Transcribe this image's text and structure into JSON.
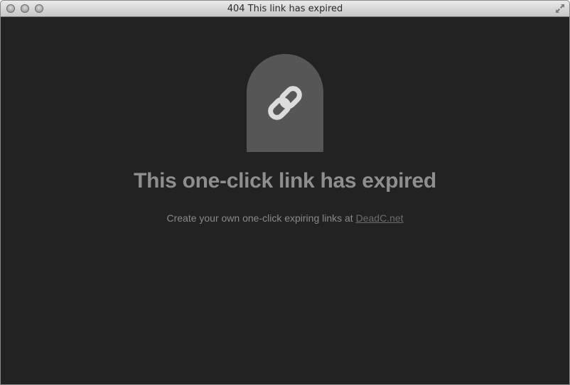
{
  "window": {
    "title": "404 This link has expired"
  },
  "page": {
    "icon": "link-chain-icon",
    "headline": "This one-click link has expired",
    "subtext": "Create your own one-click expiring links at",
    "link_text": "DeadC.net"
  },
  "colors": {
    "background": "#222222",
    "badge": "#565656",
    "headline": "#8e8e8e",
    "link": "#6c6c6c"
  }
}
